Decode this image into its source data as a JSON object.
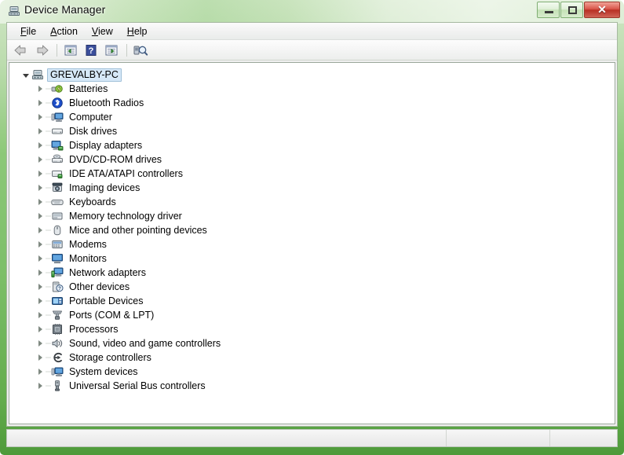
{
  "window": {
    "title": "Device Manager",
    "title_icon": "device-manager-icon",
    "controls": {
      "minimize_label": "–",
      "maximize_label": "□",
      "close_label": "✕"
    }
  },
  "menubar": {
    "items": [
      {
        "name": "file",
        "accel": "F",
        "rest": "ile"
      },
      {
        "name": "action",
        "accel": "A",
        "rest": "ction"
      },
      {
        "name": "view",
        "accel": "V",
        "rest": "iew"
      },
      {
        "name": "help",
        "accel": "H",
        "rest": "elp"
      }
    ]
  },
  "toolbar": {
    "buttons": [
      {
        "name": "back-button",
        "icon": "arrow-left-icon",
        "enabled": false
      },
      {
        "name": "forward-button",
        "icon": "arrow-right-icon",
        "enabled": false
      },
      {
        "name": "properties-button",
        "icon": "properties-list-icon",
        "enabled": true
      },
      {
        "name": "help-button",
        "icon": "question-mark-icon",
        "enabled": true
      },
      {
        "name": "show-hidden-devices-button",
        "icon": "list-forward-icon",
        "enabled": true
      },
      {
        "name": "scan-hardware-changes-button",
        "icon": "scan-magnifier-icon",
        "enabled": true
      }
    ]
  },
  "tree": {
    "root": {
      "label": "GREVALBY-PC",
      "icon": "computer-node-icon",
      "expanded": true,
      "selected": true
    },
    "children": [
      {
        "label": "Batteries",
        "icon": "battery-icon",
        "expanded": false
      },
      {
        "label": "Bluetooth Radios",
        "icon": "bluetooth-icon",
        "expanded": false
      },
      {
        "label": "Computer",
        "icon": "computer-icon",
        "expanded": false
      },
      {
        "label": "Disk drives",
        "icon": "disk-drive-icon",
        "expanded": false
      },
      {
        "label": "Display adapters",
        "icon": "display-adapter-icon",
        "expanded": false
      },
      {
        "label": "DVD/CD-ROM drives",
        "icon": "optical-drive-icon",
        "expanded": false
      },
      {
        "label": "IDE ATA/ATAPI controllers",
        "icon": "ide-controller-icon",
        "expanded": false
      },
      {
        "label": "Imaging devices",
        "icon": "camera-icon",
        "expanded": false
      },
      {
        "label": "Keyboards",
        "icon": "keyboard-icon",
        "expanded": false
      },
      {
        "label": "Memory technology driver",
        "icon": "memory-card-icon",
        "expanded": false
      },
      {
        "label": "Mice and other pointing devices",
        "icon": "mouse-icon",
        "expanded": false
      },
      {
        "label": "Modems",
        "icon": "modem-icon",
        "expanded": false
      },
      {
        "label": "Monitors",
        "icon": "monitor-icon",
        "expanded": false
      },
      {
        "label": "Network adapters",
        "icon": "network-adapter-icon",
        "expanded": false
      },
      {
        "label": "Other devices",
        "icon": "unknown-device-icon",
        "expanded": false
      },
      {
        "label": "Portable Devices",
        "icon": "portable-device-icon",
        "expanded": false
      },
      {
        "label": "Ports (COM & LPT)",
        "icon": "port-connector-icon",
        "expanded": false
      },
      {
        "label": "Processors",
        "icon": "processor-icon",
        "expanded": false
      },
      {
        "label": "Sound, video and game controllers",
        "icon": "speaker-icon",
        "expanded": false
      },
      {
        "label": "Storage controllers",
        "icon": "storage-controller-icon",
        "expanded": false
      },
      {
        "label": "System devices",
        "icon": "system-device-icon",
        "expanded": false
      },
      {
        "label": "Universal Serial Bus controllers",
        "icon": "usb-icon",
        "expanded": false
      }
    ]
  },
  "statusbar": {
    "pane1": "",
    "pane2": "",
    "pane3": ""
  },
  "colors": {
    "frame_green_light": "#cfe6c4",
    "frame_green_dark": "#4e9a3a",
    "close_red": "#b83024",
    "selection_blue": "#d6e8f7",
    "tree_background": "#ffffff"
  }
}
